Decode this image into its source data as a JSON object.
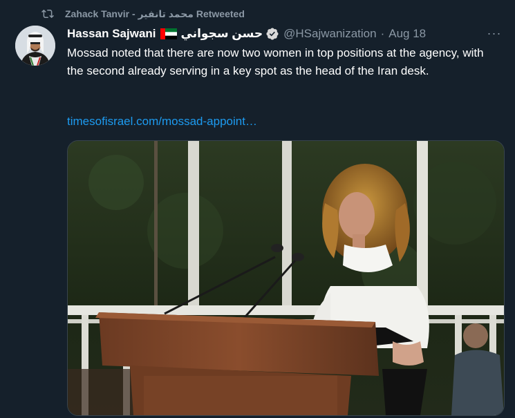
{
  "retweet": {
    "icon": "retweet-icon",
    "user": "Zahack Tanvir - محمد تانفير",
    "suffix": "Retweeted"
  },
  "tweet": {
    "display_name": "Hassan Sajwani",
    "flag": "uae-flag-icon",
    "arabic_name": "حسن سجواني",
    "verified": "verified-badge-icon",
    "handle": "@HSajwanization",
    "separator": "·",
    "date": "Aug 18",
    "more": "···",
    "text": "Mossad noted that there are now two women in top positions at the agency, with the second already serving in a key spot as the head of the Iran desk.",
    "link": "timesofisrael.com/mossad-appoint…"
  },
  "colors": {
    "background": "#15202b",
    "secondary_text": "#8b98a5",
    "link": "#1d9bf0",
    "verified": "#d9d9d9"
  }
}
